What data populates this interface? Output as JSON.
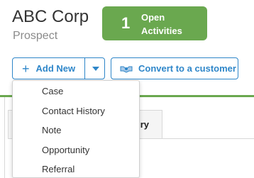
{
  "header": {
    "company_name": "ABC Corp",
    "status": "Prospect"
  },
  "activities_badge": {
    "count": "1",
    "label_line1": "Open",
    "label_line2": "Activities",
    "color": "#6aa84f"
  },
  "actions": {
    "add_new_label": "Add New",
    "add_new_icon": "plus-icon",
    "dropdown_toggle_icon": "caret-down-icon",
    "convert_label": "Convert to a customer",
    "convert_icon": "convert-handshake-icon",
    "accent_color": "#2e86c9"
  },
  "add_new_menu": {
    "items": [
      "Case",
      "Contact History",
      "Note",
      "Opportunity",
      "Referral"
    ]
  },
  "tabs": {
    "partial_tab_label": "ry"
  }
}
